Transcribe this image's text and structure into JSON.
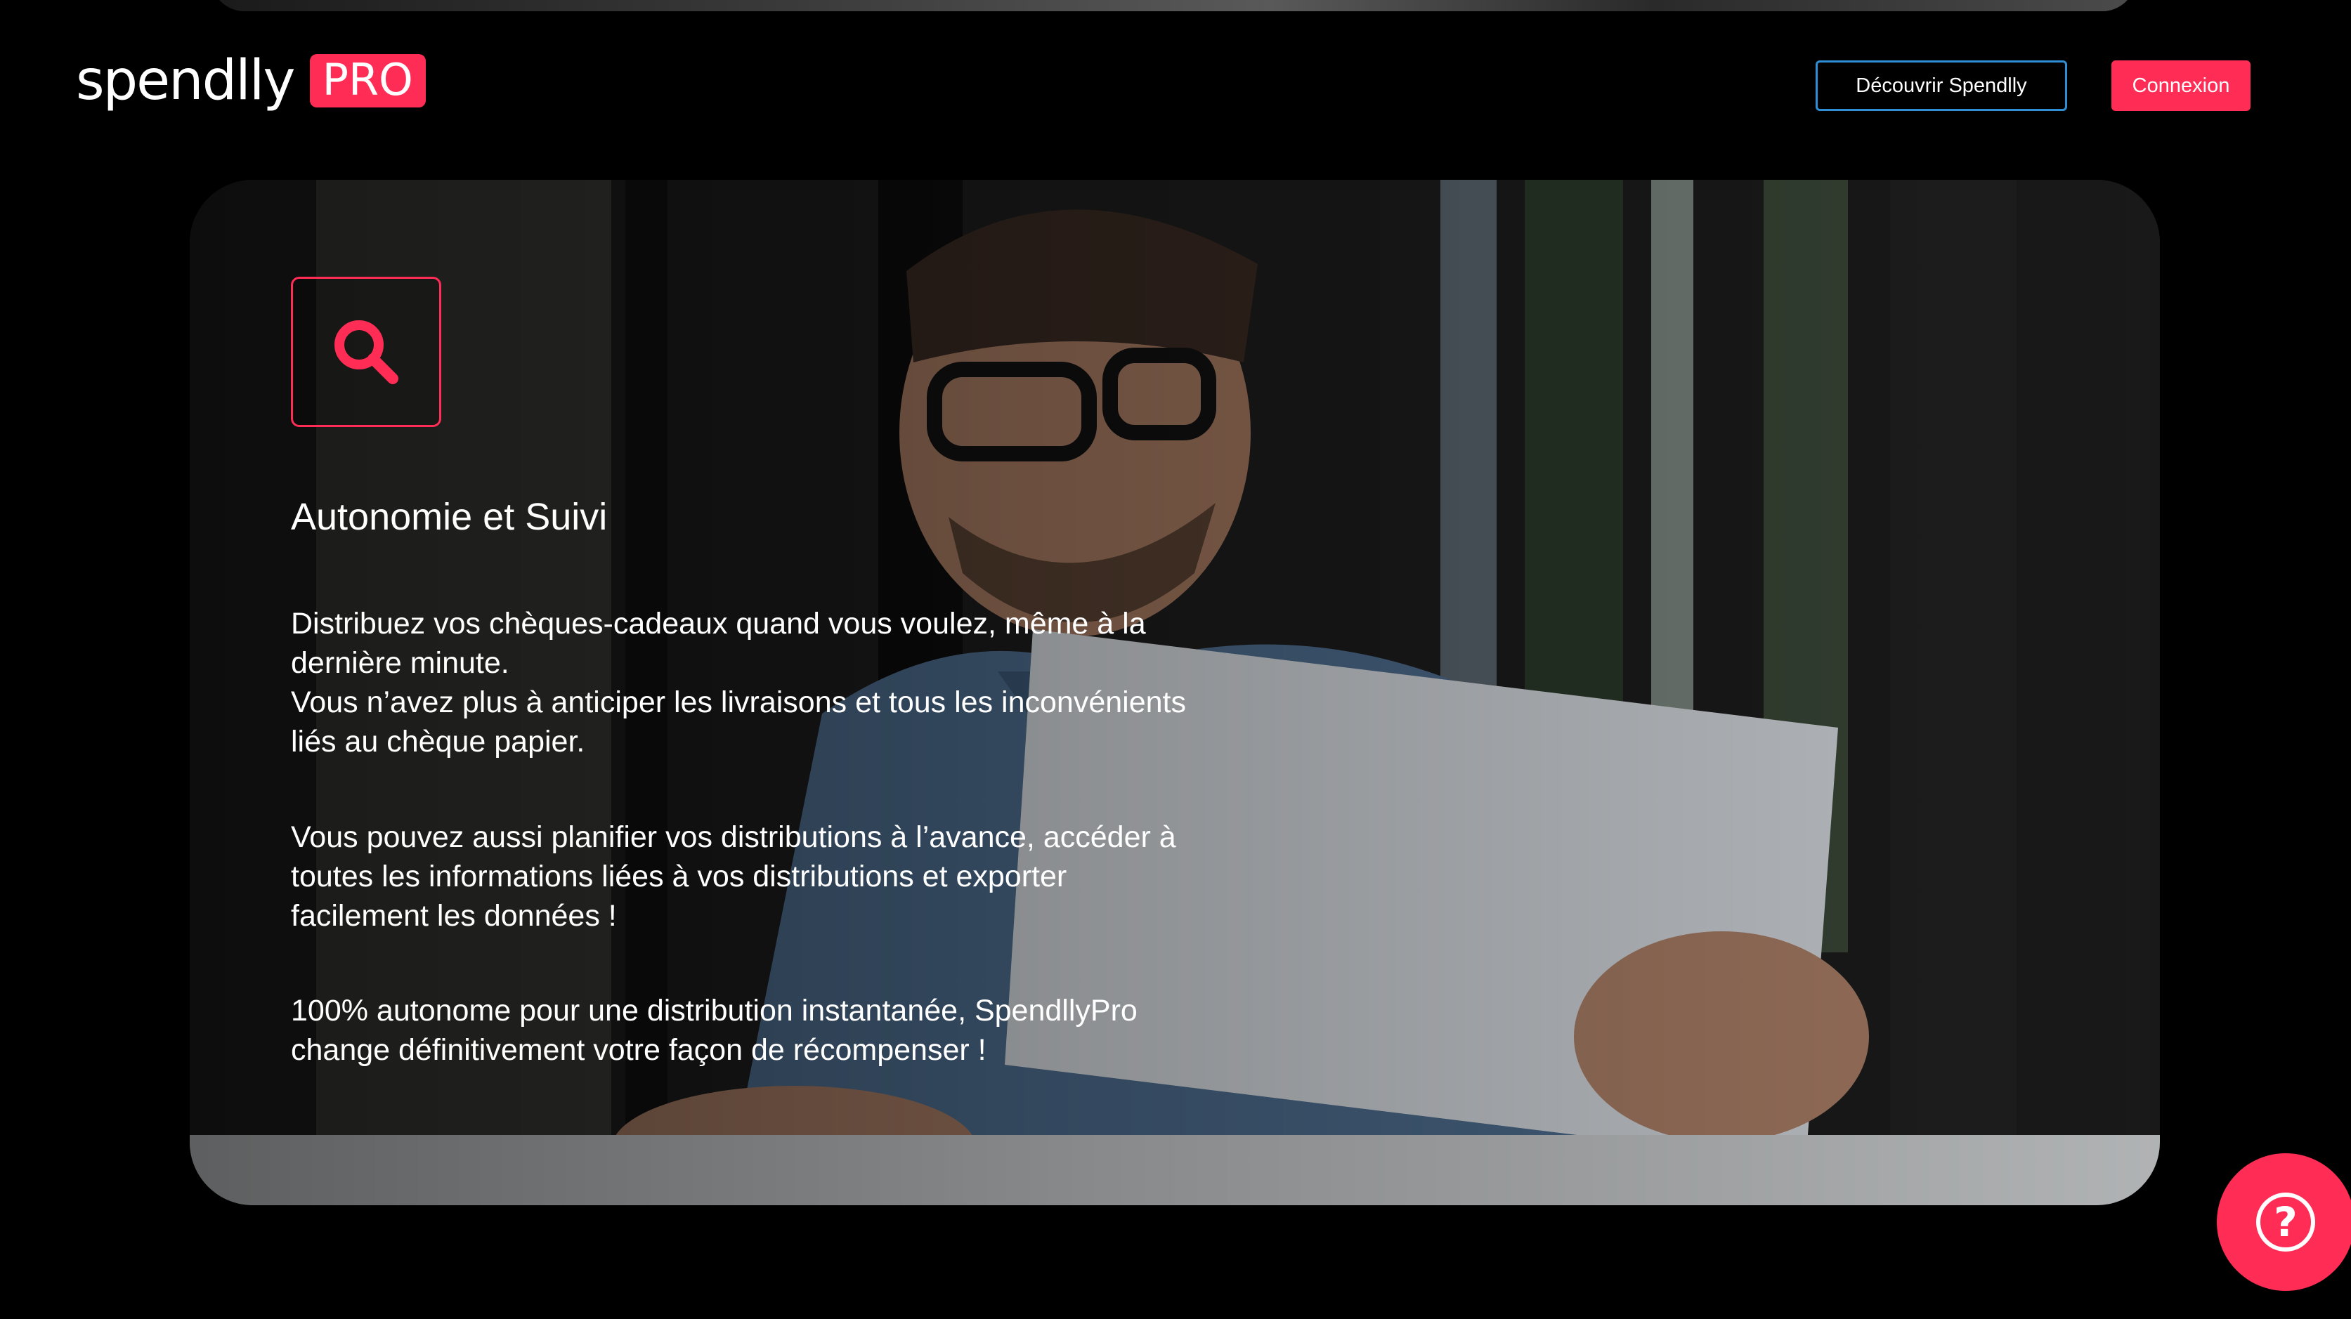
{
  "header": {
    "logo_word": "spendlly",
    "logo_badge": "PRO",
    "discover_label": "Découvrir Spendlly",
    "login_label": "Connexion"
  },
  "hero": {
    "icon": "search-icon",
    "title": "Autonomie et Suivi",
    "paragraphs": [
      "Distribuez vos chèques-cadeaux quand vous voulez, même à la dernière minute.\nVous n’avez plus à anticiper les livraisons et tous les inconvénients liés au chèque papier.",
      "Vous pouvez aussi planifier vos distributions à l’avance, accéder à toutes les informations liées à vos distributions et exporter facilement les données !",
      "100% autonome pour une distribution instantanée, SpendllyPro change définitivement votre façon de récompenser !"
    ]
  },
  "help": {
    "icon": "help-question-icon",
    "glyph": "?"
  },
  "colors": {
    "accent": "#ff2d55",
    "outline_button": "#2f8fd6",
    "background": "#000000"
  }
}
